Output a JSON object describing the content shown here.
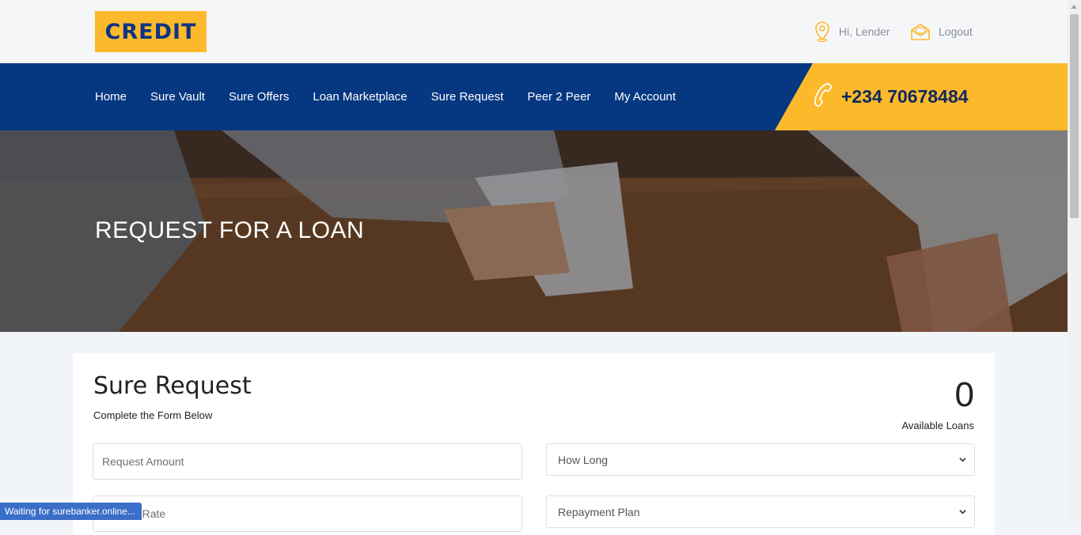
{
  "header": {
    "logo_text": "CREDIT",
    "greeting": "Hi, Lender",
    "logout_label": "Logout"
  },
  "nav": {
    "items": [
      {
        "label": "Home"
      },
      {
        "label": "Sure Vault"
      },
      {
        "label": "Sure Offers"
      },
      {
        "label": "Loan Marketplace"
      },
      {
        "label": "Sure Request"
      },
      {
        "label": "Peer 2 Peer"
      },
      {
        "label": "My Account"
      }
    ],
    "phone": "+234 70678484"
  },
  "hero": {
    "title": "REQUEST FOR A LOAN"
  },
  "form": {
    "title": "Sure Request",
    "subtitle": "Complete the Form Below",
    "available_count": "0",
    "available_label": "Available Loans",
    "request_amount_placeholder": "Request Amount",
    "how_long_selected": "How Long",
    "interest_rate_placeholder": "Interest Rate",
    "repayment_plan_selected": "Repayment Plan"
  },
  "status_bar": {
    "text": "Waiting for surebanker.online..."
  },
  "colors": {
    "brand_yellow": "#fdb92c",
    "brand_navy": "#063781"
  }
}
